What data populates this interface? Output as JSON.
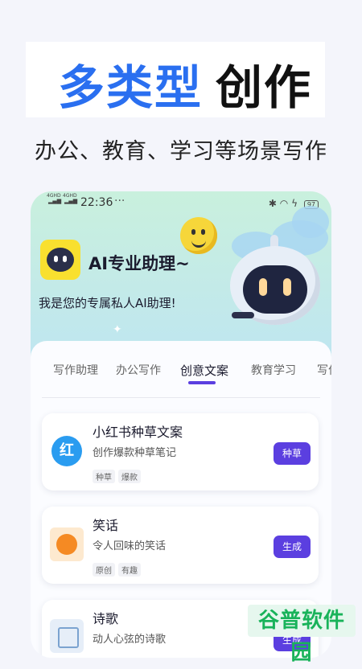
{
  "hero": {
    "title_blue": "多类型",
    "title_black": "创作",
    "subtitle": "办公、教育、学习等场景写作"
  },
  "status_bar": {
    "signal_1": "4GHD",
    "signal_2": "4GHD",
    "time": "22:36",
    "more": "···",
    "battery": "97"
  },
  "app": {
    "title": "AI专业助理~",
    "subtitle": "我是您的专属私人AI助理!"
  },
  "tabs": [
    {
      "label": "写作助理"
    },
    {
      "label": "办公写作"
    },
    {
      "label": "创意文案"
    },
    {
      "label": "教育学习"
    },
    {
      "label": "写作"
    }
  ],
  "active_tab_index": 2,
  "cards": [
    {
      "title": "小红书种草文案",
      "desc": "创作爆款种草笔记",
      "tags": [
        "种草",
        "爆款"
      ],
      "button": "种草",
      "icon": "xiaohongshu-icon",
      "icon_glyph": "红"
    },
    {
      "title": "笑话",
      "desc": "令人回味的笑话",
      "tags": [
        "原创",
        "有趣"
      ],
      "button": "生成",
      "icon": "laughing-face-icon"
    },
    {
      "title": "诗歌",
      "desc": "动人心弦的诗歌",
      "tags": [],
      "button": "生成",
      "icon": "poem-scroll-icon"
    }
  ],
  "watermark": "谷普软件园",
  "colors": {
    "accent": "#5b3fe0",
    "hero_blue": "#2a6ff0",
    "watermark_green": "#19b35a"
  }
}
